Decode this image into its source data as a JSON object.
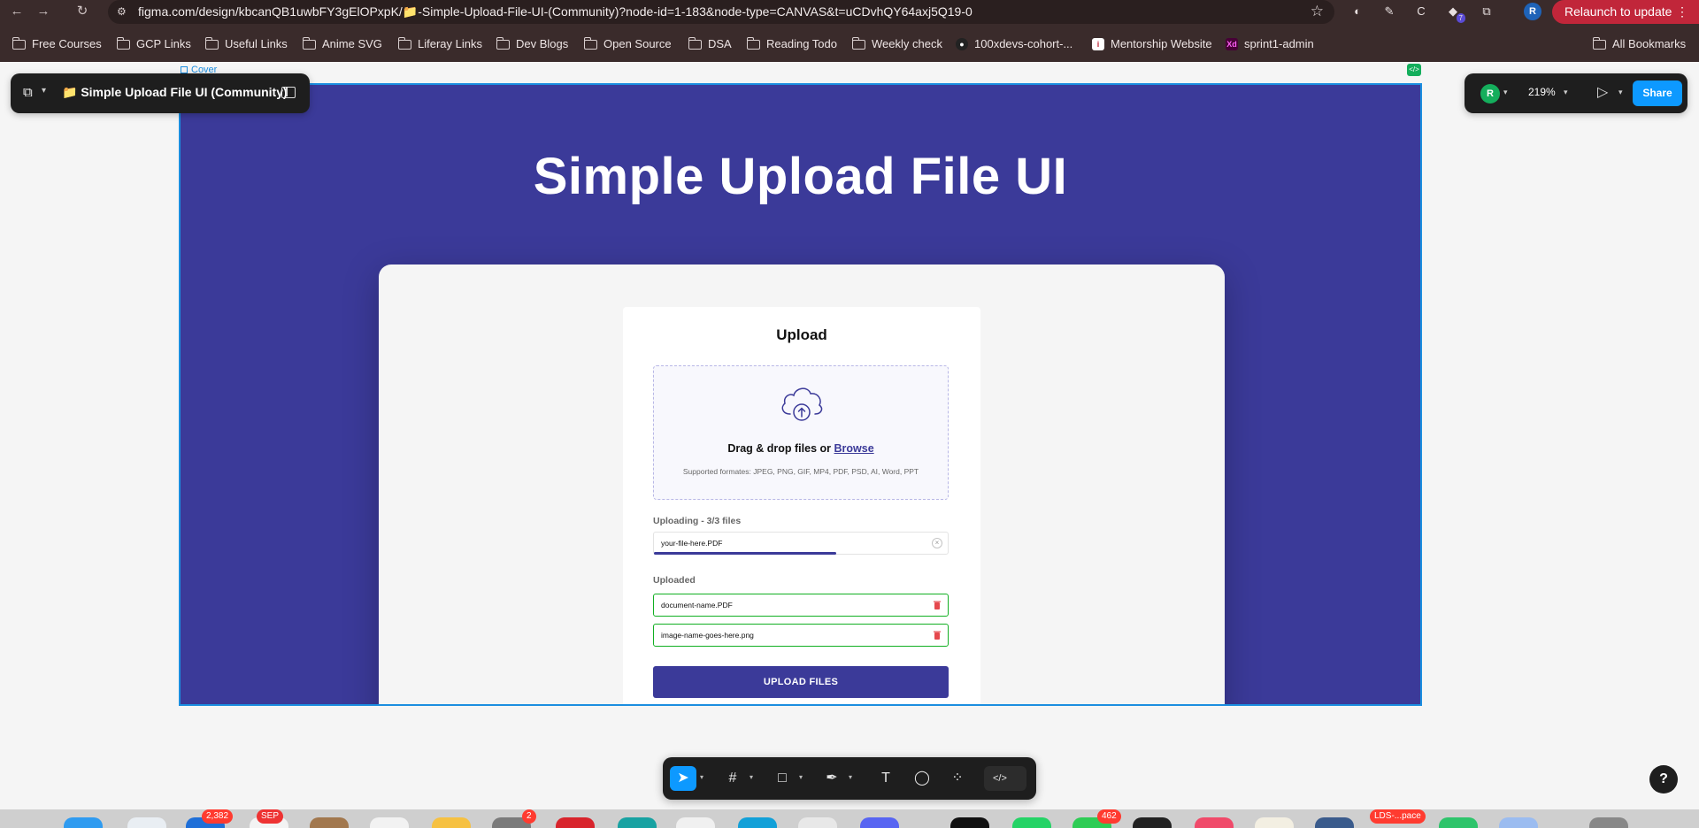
{
  "browser": {
    "url": "figma.com/design/kbcanQB1uwbFY3gElOPxpK/📁-Simple-Upload-File-UI-(Community)?node-id=1-183&node-type=CANVAS&t=uCDvhQY64axj5Q19-0",
    "relaunch_label": "Relaunch to update",
    "profile_initial": "R",
    "extension_badge": "7",
    "bookmarks": [
      "Free Courses",
      "GCP Links",
      "Useful Links",
      "Anime SVG",
      "Liferay Links",
      "Dev Blogs",
      "Open Source",
      "DSA",
      "Reading Todo",
      "Weekly check",
      "100xdevs-cohort-...",
      "Mentorship Website",
      "sprint1-admin"
    ],
    "all_bookmarks_label": "All Bookmarks"
  },
  "figma": {
    "file_title": "📁 Simple Upload File UI (Community)",
    "frame_label": "Cover",
    "user_initial": "R",
    "zoom": "219%",
    "share_label": "Share",
    "help_label": "?"
  },
  "design": {
    "cover_title": "Simple Upload File UI",
    "card_heading": "Upload",
    "drag_text": "Drag & drop files or",
    "browse_link": "Browse",
    "formats_text": "Supported formates: JPEG, PNG, GIF, MP4, PDF, PSD, AI, Word, PPT",
    "uploading_label": "Uploading - 3/3 files",
    "uploading_file": "your-file-here.PDF",
    "upload_progress": 0.62,
    "uploaded_label": "Uploaded",
    "uploaded_files": [
      "document-name.PDF",
      "image-name-goes-here.png"
    ],
    "upload_button": "UPLOAD FILES"
  },
  "dock": {
    "badges": [
      "2,382",
      "SEP",
      "2",
      "462",
      "LDS-...pace"
    ]
  },
  "colors": {
    "cover_bg": "#3b3a99",
    "accent": "#3b3a99",
    "success_border": "#11af22",
    "figma_blue": "#0d99ff",
    "relaunch_red": "#c1263a"
  }
}
